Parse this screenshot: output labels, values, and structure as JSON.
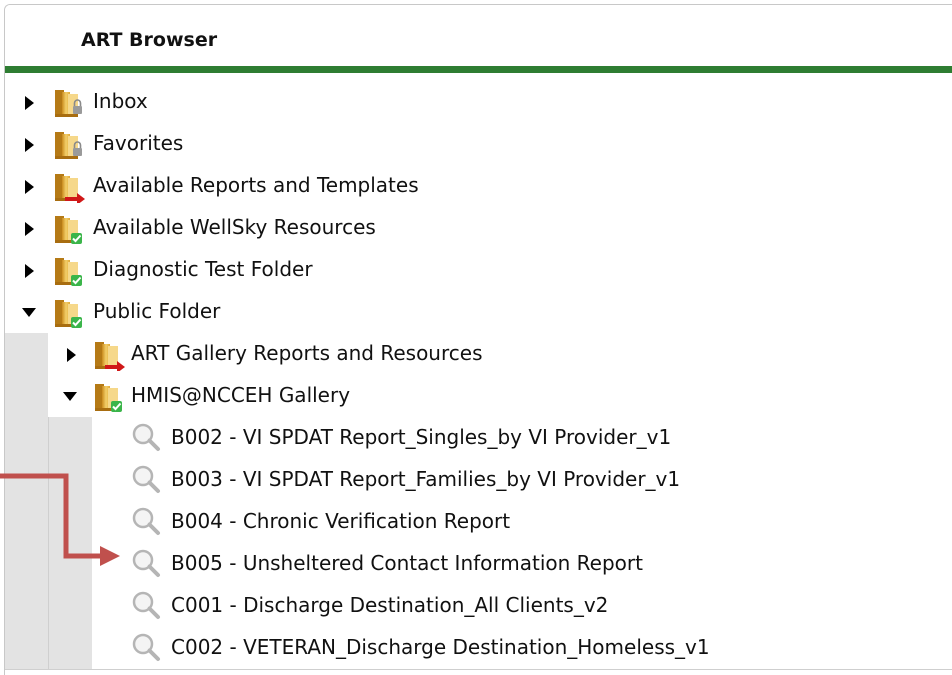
{
  "header": {
    "title": "ART Browser"
  },
  "colors": {
    "accent_green": "#2e7d32",
    "annotation_red": "#c0504d"
  },
  "tree": {
    "top_items": [
      {
        "label": "Inbox",
        "icon": "folder-lock-icon",
        "expanded": false
      },
      {
        "label": "Favorites",
        "icon": "folder-lock-icon",
        "expanded": false
      },
      {
        "label": "Available Reports and Templates",
        "icon": "folder-shortcut-icon",
        "expanded": false
      },
      {
        "label": "Available WellSky Resources",
        "icon": "folder-check-icon",
        "expanded": false
      },
      {
        "label": "Diagnostic Test Folder",
        "icon": "folder-check-icon",
        "expanded": false
      },
      {
        "label": "Public Folder",
        "icon": "folder-check-icon",
        "expanded": true
      }
    ],
    "public_children": [
      {
        "label": "ART Gallery Reports and Resources",
        "icon": "folder-shortcut-icon",
        "expanded": false
      },
      {
        "label": "HMIS@NCCEH Gallery",
        "icon": "folder-check-icon",
        "expanded": true
      }
    ],
    "gallery_reports": [
      {
        "label": "B002 - VI SPDAT Report_Singles_by VI Provider_v1"
      },
      {
        "label": "B003 - VI SPDAT Report_Families_by VI Provider_v1"
      },
      {
        "label": "B004 - Chronic Verification Report"
      },
      {
        "label": "B005 - Unsheltered Contact Information Report"
      },
      {
        "label": "C001 - Discharge Destination_All Clients_v2"
      },
      {
        "label": "C002 - VETERAN_Discharge Destination_Homeless_v1"
      }
    ]
  }
}
